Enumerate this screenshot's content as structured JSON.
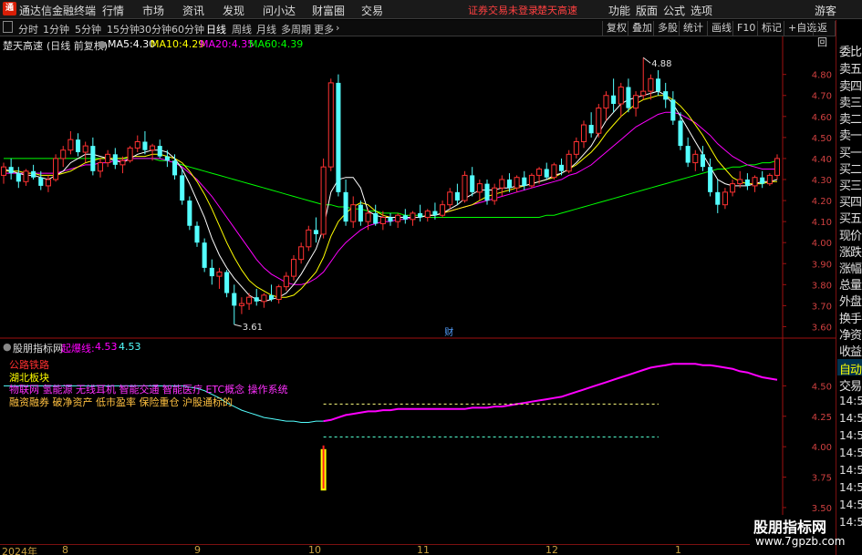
{
  "app": {
    "title": "通达信金融终端",
    "logo_char": "通",
    "menu": [
      "行情",
      "市场",
      "资讯",
      "发现",
      "问小达",
      "财富圈",
      "交易"
    ],
    "notice_trading": "证券交易未登录",
    "notice_stock": "楚天高速",
    "right_menu": [
      "功能",
      "版面",
      "公式",
      "选项"
    ],
    "guest": "游客"
  },
  "periods": {
    "icon": "expand-icon",
    "tabs": [
      "分时",
      "1分钟",
      "5分钟",
      "15分钟",
      "30分钟",
      "60分钟",
      "日线",
      "周线",
      "月线",
      "多周期",
      "更多"
    ],
    "active": "日线",
    "tools": [
      "复权",
      "叠加",
      "多股",
      "统计",
      "画线",
      "F10",
      "标记",
      "+自选",
      "返回"
    ]
  },
  "main_chart": {
    "stock_name": "楚天高速",
    "period_info": "(日线 前复权)",
    "ma": [
      {
        "label": "MA5:",
        "value": "4.30",
        "color": "#ffffff"
      },
      {
        "label": "MA10:",
        "value": "4.29",
        "color": "#ffff00"
      },
      {
        "label": "MA20:",
        "value": "4.35",
        "color": "#ff00ff"
      },
      {
        "label": "MA60:",
        "value": "4.39",
        "color": "#00ff00"
      }
    ],
    "y_ticks": [
      "4.80",
      "4.70",
      "4.60",
      "4.50",
      "4.40",
      "4.30",
      "4.20",
      "4.10",
      "4.00",
      "3.90",
      "3.80",
      "3.70",
      "3.60"
    ],
    "high_label": "4.88",
    "low_label": "3.61",
    "marker": "财"
  },
  "indicator": {
    "name": "股朋指标网",
    "line_label": "起爆线:",
    "values": [
      "4.53",
      "4.53"
    ],
    "y_ticks": [
      "4.50",
      "4.25",
      "4.00",
      "3.75",
      "3.50",
      "3.25"
    ],
    "legend": [
      {
        "text": "公路铁路",
        "color": "#ff3030"
      },
      {
        "text": "湖北板块",
        "color": "#ffff00"
      },
      {
        "text": "物联网 氢能源 无线耳机 智能交通 智能医疗 ETC概念 操作系统",
        "color": "#ff30ff"
      },
      {
        "text": "融资融券 破净资产 低市盈率 保险重仓 沪股通标的",
        "color": "#ffc040"
      }
    ]
  },
  "side_panel": {
    "items": [
      "委比",
      "卖五",
      "卖四",
      "卖三",
      "卖二",
      "卖一",
      "买一",
      "买二",
      "买三",
      "买四",
      "买五",
      "现价",
      "涨跌",
      "涨幅",
      "总量",
      "外盘",
      "换手",
      "净资",
      "收益"
    ],
    "tabs": [
      "自动",
      "交易"
    ],
    "times": [
      "14:5",
      "14:5",
      "14:5",
      "14:5",
      "14:5",
      "14:5",
      "14:5",
      "14:5"
    ]
  },
  "date_axis": [
    "2024年",
    "8",
    "9",
    "10",
    "11",
    "12",
    "1"
  ],
  "watermark": {
    "line1": "股朋指标网",
    "line2": "www.7gpzb.com"
  },
  "colors": {
    "up": "#ff3232",
    "down": "#54ffff",
    "ma5": "#ffffff",
    "ma10": "#ffff00",
    "ma20": "#ff00ff",
    "ma60": "#00ff00",
    "axis": "#a01010"
  },
  "chart_data": {
    "type": "candlestick",
    "title": "楚天高速",
    "period": "日线",
    "ylim": [
      3.55,
      4.92
    ],
    "x_month_labels": [
      "8",
      "9",
      "10",
      "11",
      "12",
      "1"
    ],
    "candles": [
      [
        4.32,
        4.38,
        4.28,
        4.36
      ],
      [
        4.36,
        4.4,
        4.3,
        4.33
      ],
      [
        4.33,
        4.36,
        4.26,
        4.29
      ],
      [
        4.29,
        4.35,
        4.27,
        4.34
      ],
      [
        4.34,
        4.37,
        4.3,
        4.31
      ],
      [
        4.31,
        4.34,
        4.25,
        4.27
      ],
      [
        4.27,
        4.32,
        4.24,
        4.3
      ],
      [
        4.3,
        4.42,
        4.29,
        4.4
      ],
      [
        4.4,
        4.46,
        4.36,
        4.44
      ],
      [
        4.44,
        4.53,
        4.42,
        4.49
      ],
      [
        4.49,
        4.52,
        4.41,
        4.43
      ],
      [
        4.43,
        4.48,
        4.38,
        4.46
      ],
      [
        4.46,
        4.5,
        4.32,
        4.34
      ],
      [
        4.34,
        4.4,
        4.31,
        4.38
      ],
      [
        4.38,
        4.44,
        4.36,
        4.42
      ],
      [
        4.42,
        4.45,
        4.35,
        4.37
      ],
      [
        4.37,
        4.41,
        4.33,
        4.39
      ],
      [
        4.39,
        4.46,
        4.38,
        4.45
      ],
      [
        4.45,
        4.51,
        4.43,
        4.48
      ],
      [
        4.48,
        4.53,
        4.42,
        4.44
      ],
      [
        4.44,
        4.47,
        4.39,
        4.46
      ],
      [
        4.46,
        4.49,
        4.4,
        4.41
      ],
      [
        4.41,
        4.44,
        4.36,
        4.39
      ],
      [
        4.39,
        4.42,
        4.3,
        4.32
      ],
      [
        4.32,
        4.35,
        4.18,
        4.2
      ],
      [
        4.2,
        4.22,
        4.06,
        4.08
      ],
      [
        4.08,
        4.1,
        3.98,
        4.0
      ],
      [
        4.0,
        4.02,
        3.86,
        3.88
      ],
      [
        3.88,
        3.92,
        3.8,
        3.84
      ],
      [
        3.84,
        3.88,
        3.78,
        3.86
      ],
      [
        3.86,
        3.87,
        3.74,
        3.76
      ],
      [
        3.76,
        3.8,
        3.61,
        3.7
      ],
      [
        3.7,
        3.74,
        3.66,
        3.71
      ],
      [
        3.71,
        3.76,
        3.68,
        3.74
      ],
      [
        3.74,
        3.78,
        3.7,
        3.72
      ],
      [
        3.72,
        3.76,
        3.69,
        3.75
      ],
      [
        3.75,
        3.8,
        3.72,
        3.73
      ],
      [
        3.73,
        3.8,
        3.71,
        3.79
      ],
      [
        3.79,
        3.86,
        3.77,
        3.84
      ],
      [
        3.84,
        3.94,
        3.82,
        3.92
      ],
      [
        3.92,
        4.0,
        3.9,
        3.98
      ],
      [
        3.98,
        4.08,
        3.96,
        4.06
      ],
      [
        4.06,
        4.12,
        4.0,
        4.04
      ],
      [
        4.04,
        4.4,
        4.02,
        4.36
      ],
      [
        4.36,
        4.78,
        4.34,
        4.76
      ],
      [
        4.76,
        4.8,
        4.22,
        4.24
      ],
      [
        4.24,
        4.3,
        4.08,
        4.1
      ],
      [
        4.1,
        4.22,
        4.07,
        4.18
      ],
      [
        4.18,
        4.2,
        4.08,
        4.1
      ],
      [
        4.1,
        4.16,
        4.06,
        4.14
      ],
      [
        4.14,
        4.18,
        4.08,
        4.09
      ],
      [
        4.09,
        4.15,
        4.06,
        4.12
      ],
      [
        4.12,
        4.14,
        4.08,
        4.1
      ],
      [
        4.1,
        4.14,
        4.07,
        4.13
      ],
      [
        4.13,
        4.16,
        4.09,
        4.11
      ],
      [
        4.11,
        4.15,
        4.08,
        4.14
      ],
      [
        4.14,
        4.18,
        4.1,
        4.12
      ],
      [
        4.12,
        4.16,
        4.1,
        4.15
      ],
      [
        4.15,
        4.19,
        4.11,
        4.13
      ],
      [
        4.13,
        4.2,
        4.12,
        4.18
      ],
      [
        4.18,
        4.26,
        4.16,
        4.24
      ],
      [
        4.24,
        4.28,
        4.18,
        4.2
      ],
      [
        4.2,
        4.34,
        4.19,
        4.32
      ],
      [
        4.32,
        4.36,
        4.22,
        4.24
      ],
      [
        4.24,
        4.3,
        4.2,
        4.28
      ],
      [
        4.28,
        4.3,
        4.18,
        4.2
      ],
      [
        4.2,
        4.28,
        4.18,
        4.26
      ],
      [
        4.26,
        4.32,
        4.22,
        4.3
      ],
      [
        4.3,
        4.33,
        4.24,
        4.26
      ],
      [
        4.26,
        4.32,
        4.24,
        4.31
      ],
      [
        4.31,
        4.34,
        4.25,
        4.27
      ],
      [
        4.27,
        4.33,
        4.26,
        4.32
      ],
      [
        4.32,
        4.36,
        4.28,
        4.35
      ],
      [
        4.35,
        4.38,
        4.3,
        4.31
      ],
      [
        4.31,
        4.38,
        4.3,
        4.37
      ],
      [
        4.37,
        4.4,
        4.32,
        4.34
      ],
      [
        4.34,
        4.44,
        4.33,
        4.42
      ],
      [
        4.42,
        4.5,
        4.4,
        4.48
      ],
      [
        4.48,
        4.58,
        4.45,
        4.56
      ],
      [
        4.56,
        4.62,
        4.5,
        4.52
      ],
      [
        4.52,
        4.66,
        4.5,
        4.64
      ],
      [
        4.64,
        4.72,
        4.58,
        4.7
      ],
      [
        4.7,
        4.78,
        4.62,
        4.66
      ],
      [
        4.66,
        4.76,
        4.6,
        4.74
      ],
      [
        4.74,
        4.78,
        4.62,
        4.64
      ],
      [
        4.64,
        4.72,
        4.6,
        4.7
      ],
      [
        4.7,
        4.88,
        4.68,
        4.72
      ],
      [
        4.72,
        4.8,
        4.68,
        4.78
      ],
      [
        4.78,
        4.82,
        4.7,
        4.72
      ],
      [
        4.72,
        4.76,
        4.64,
        4.68
      ],
      [
        4.68,
        4.72,
        4.56,
        4.58
      ],
      [
        4.58,
        4.62,
        4.44,
        4.46
      ],
      [
        4.46,
        4.5,
        4.36,
        4.38
      ],
      [
        4.38,
        4.44,
        4.34,
        4.42
      ],
      [
        4.42,
        4.46,
        4.34,
        4.36
      ],
      [
        4.36,
        4.4,
        4.22,
        4.24
      ],
      [
        4.24,
        4.3,
        4.14,
        4.18
      ],
      [
        4.18,
        4.26,
        4.16,
        4.24
      ],
      [
        4.24,
        4.3,
        4.22,
        4.28
      ],
      [
        4.28,
        4.34,
        4.26,
        4.3
      ],
      [
        4.3,
        4.33,
        4.25,
        4.27
      ],
      [
        4.27,
        4.32,
        4.24,
        4.31
      ],
      [
        4.31,
        4.34,
        4.26,
        4.28
      ],
      [
        4.28,
        4.33,
        4.27,
        4.32
      ],
      [
        4.32,
        4.42,
        4.3,
        4.4
      ]
    ],
    "ma5": [
      4.35,
      4.34,
      4.33,
      4.32,
      4.32,
      4.31,
      4.3,
      4.32,
      4.34,
      4.38,
      4.4,
      4.42,
      4.42,
      4.41,
      4.4,
      4.39,
      4.38,
      4.4,
      4.42,
      4.43,
      4.44,
      4.44,
      4.43,
      4.4,
      4.35,
      4.28,
      4.2,
      4.12,
      4.02,
      3.94,
      3.88,
      3.83,
      3.79,
      3.75,
      3.73,
      3.72,
      3.73,
      3.74,
      3.76,
      3.8,
      3.85,
      3.91,
      3.97,
      4.07,
      4.24,
      4.3,
      4.31,
      4.31,
      4.26,
      4.15,
      4.13,
      4.12,
      4.12,
      4.12,
      4.12,
      4.12,
      4.12,
      4.13,
      4.13,
      4.14,
      4.16,
      4.18,
      4.21,
      4.23,
      4.25,
      4.25,
      4.25,
      4.26,
      4.26,
      4.27,
      4.27,
      4.28,
      4.29,
      4.3,
      4.32,
      4.33,
      4.35,
      4.38,
      4.42,
      4.46,
      4.52,
      4.58,
      4.62,
      4.66,
      4.68,
      4.69,
      4.7,
      4.71,
      4.72,
      4.7,
      4.66,
      4.6,
      4.54,
      4.48,
      4.42,
      4.36,
      4.3,
      4.28,
      4.27,
      4.27,
      4.27,
      4.28,
      4.29,
      4.29,
      4.3
    ],
    "ma10": [
      4.34,
      4.34,
      4.34,
      4.33,
      4.33,
      4.32,
      4.32,
      4.32,
      4.33,
      4.34,
      4.36,
      4.38,
      4.39,
      4.4,
      4.4,
      4.4,
      4.4,
      4.41,
      4.41,
      4.41,
      4.42,
      4.42,
      4.41,
      4.4,
      4.38,
      4.34,
      4.29,
      4.23,
      4.16,
      4.08,
      4.0,
      3.93,
      3.87,
      3.82,
      3.79,
      3.77,
      3.75,
      3.74,
      3.74,
      3.75,
      3.78,
      3.82,
      3.86,
      3.93,
      4.03,
      4.1,
      4.14,
      4.17,
      4.19,
      4.18,
      4.15,
      4.13,
      4.12,
      4.12,
      4.12,
      4.12,
      4.12,
      4.13,
      4.13,
      4.14,
      4.15,
      4.16,
      4.17,
      4.18,
      4.2,
      4.22,
      4.23,
      4.24,
      4.25,
      4.26,
      4.27,
      4.28,
      4.29,
      4.3,
      4.31,
      4.33,
      4.35,
      4.37,
      4.4,
      4.43,
      4.47,
      4.52,
      4.56,
      4.6,
      4.63,
      4.66,
      4.68,
      4.69,
      4.7,
      4.7,
      4.68,
      4.65,
      4.61,
      4.56,
      4.51,
      4.45,
      4.39,
      4.35,
      4.31,
      4.29,
      4.28,
      4.28,
      4.28,
      4.29,
      4.29
    ],
    "ma20": [
      4.33,
      4.33,
      4.33,
      4.33,
      4.33,
      4.33,
      4.33,
      4.33,
      4.34,
      4.35,
      4.36,
      4.37,
      4.37,
      4.38,
      4.38,
      4.39,
      4.39,
      4.4,
      4.4,
      4.4,
      4.4,
      4.4,
      4.39,
      4.38,
      4.36,
      4.33,
      4.3,
      4.26,
      4.22,
      4.17,
      4.12,
      4.07,
      4.02,
      3.97,
      3.92,
      3.88,
      3.85,
      3.83,
      3.81,
      3.8,
      3.8,
      3.81,
      3.83,
      3.86,
      3.91,
      3.96,
      4.0,
      4.03,
      4.06,
      4.08,
      4.09,
      4.1,
      4.1,
      4.11,
      4.11,
      4.12,
      4.12,
      4.13,
      4.13,
      4.14,
      4.15,
      4.16,
      4.17,
      4.18,
      4.19,
      4.2,
      4.21,
      4.22,
      4.23,
      4.24,
      4.25,
      4.26,
      4.27,
      4.28,
      4.29,
      4.3,
      4.32,
      4.33,
      4.35,
      4.37,
      4.4,
      4.43,
      4.46,
      4.49,
      4.52,
      4.55,
      4.57,
      4.59,
      4.61,
      4.62,
      4.62,
      4.61,
      4.59,
      4.57,
      4.54,
      4.51,
      4.47,
      4.44,
      4.41,
      4.39,
      4.37,
      4.36,
      4.35,
      4.35,
      4.35
    ],
    "ma60": [
      4.4,
      4.4,
      4.4,
      4.4,
      4.4,
      4.4,
      4.4,
      4.4,
      4.4,
      4.4,
      4.4,
      4.4,
      4.4,
      4.4,
      4.4,
      4.4,
      4.4,
      4.4,
      4.4,
      4.4,
      4.4,
      4.39,
      4.39,
      4.38,
      4.37,
      4.36,
      4.35,
      4.34,
      4.33,
      4.32,
      4.31,
      4.3,
      4.29,
      4.28,
      4.27,
      4.26,
      4.25,
      4.24,
      4.23,
      4.22,
      4.21,
      4.2,
      4.19,
      4.18,
      4.18,
      4.17,
      4.17,
      4.16,
      4.16,
      4.15,
      4.15,
      4.14,
      4.14,
      4.14,
      4.13,
      4.13,
      4.13,
      4.12,
      4.12,
      4.12,
      4.12,
      4.12,
      4.12,
      4.12,
      4.12,
      4.12,
      4.12,
      4.12,
      4.12,
      4.12,
      4.12,
      4.12,
      4.12,
      4.13,
      4.13,
      4.14,
      4.15,
      4.16,
      4.17,
      4.18,
      4.19,
      4.2,
      4.21,
      4.22,
      4.23,
      4.24,
      4.25,
      4.26,
      4.27,
      4.28,
      4.29,
      4.3,
      4.31,
      4.32,
      4.33,
      4.34,
      4.35,
      4.35,
      4.36,
      4.36,
      4.37,
      4.37,
      4.38,
      4.38,
      4.39
    ],
    "indicator_line": {
      "ylim": [
        3.2,
        4.75
      ],
      "values": [
        4.5,
        4.5,
        4.5,
        4.5,
        4.5,
        4.5,
        4.5,
        4.5,
        4.5,
        4.5,
        4.5,
        4.5,
        4.5,
        4.5,
        4.5,
        4.5,
        4.5,
        4.5,
        4.5,
        4.5,
        4.5,
        4.5,
        4.5,
        4.5,
        4.5,
        4.49,
        4.48,
        4.46,
        4.43,
        4.4,
        4.36,
        4.33,
        4.3,
        4.28,
        4.26,
        4.24,
        4.23,
        4.22,
        4.21,
        4.21,
        4.2,
        4.2,
        4.21,
        4.21,
        4.22,
        4.24,
        4.26,
        4.27,
        4.28,
        4.29,
        4.29,
        4.3,
        4.3,
        4.31,
        4.31,
        4.31,
        4.31,
        4.31,
        4.31,
        4.31,
        4.31,
        4.31,
        4.31,
        4.32,
        4.32,
        4.32,
        4.33,
        4.33,
        4.34,
        4.35,
        4.36,
        4.37,
        4.38,
        4.39,
        4.4,
        4.41,
        4.43,
        4.45,
        4.47,
        4.49,
        4.51,
        4.53,
        4.55,
        4.57,
        4.59,
        4.61,
        4.63,
        4.65,
        4.66,
        4.67,
        4.68,
        4.68,
        4.68,
        4.68,
        4.67,
        4.67,
        4.66,
        4.65,
        4.64,
        4.62,
        4.61,
        4.59,
        4.57,
        4.56,
        4.55
      ],
      "signal_index": 43,
      "bars_up": [
        4.13,
        3.7
      ],
      "level_upper": 4.35,
      "level_lower": 4.08
    }
  }
}
